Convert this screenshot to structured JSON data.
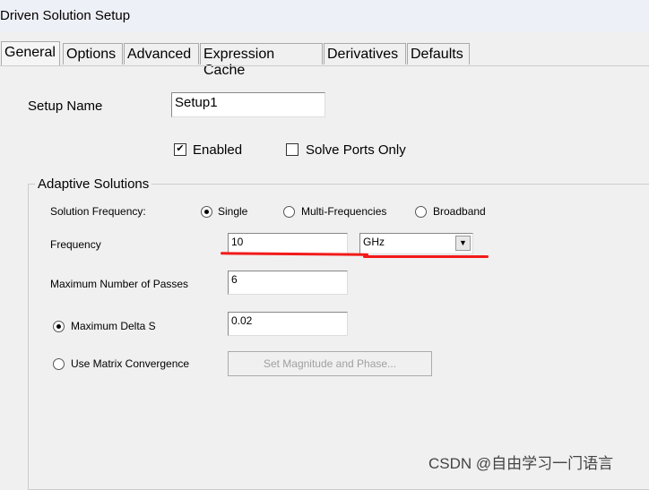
{
  "window": {
    "title": "Driven Solution Setup"
  },
  "tabs": [
    {
      "label": "General",
      "active": true
    },
    {
      "label": "Options"
    },
    {
      "label": "Advanced"
    },
    {
      "label": "Expression Cache"
    },
    {
      "label": "Derivatives"
    },
    {
      "label": "Defaults"
    }
  ],
  "setup_name": {
    "label": "Setup Name",
    "value": "Setup1"
  },
  "enabled": {
    "label": "Enabled",
    "checked": true
  },
  "solve_ports_only": {
    "label": "Solve Ports Only",
    "checked": false
  },
  "adaptive": {
    "title": "Adaptive Solutions",
    "solution_frequency_label": "Solution Frequency:",
    "options": [
      "Single",
      "Multi-Frequencies",
      "Broadband"
    ],
    "selected": "Single",
    "frequency_label": "Frequency",
    "frequency_value": "10",
    "frequency_unit": "GHz",
    "max_passes_label": "Maximum Number of Passes",
    "max_passes_value": "6",
    "max_delta_s_label": "Maximum Delta S",
    "max_delta_s_value": "0.02",
    "matrix_convergence_label": "Use Matrix Convergence",
    "set_mag_phase_label": "Set Magnitude and Phase..."
  },
  "watermark": "CSDN @自由学习一门语言",
  "annotation_color": "#f21a1a"
}
